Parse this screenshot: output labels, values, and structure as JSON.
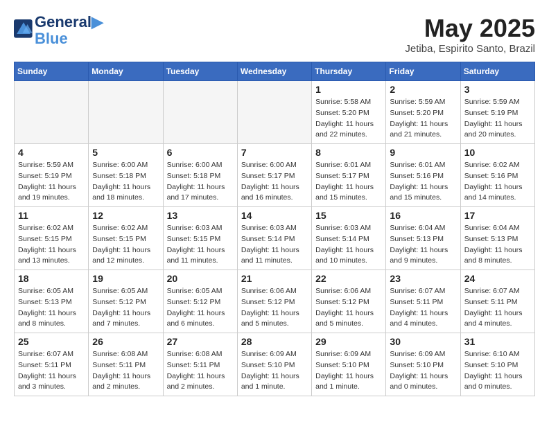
{
  "logo": {
    "line1": "General",
    "line2": "Blue"
  },
  "title": "May 2025",
  "subtitle": "Jetiba, Espirito Santo, Brazil",
  "weekdays": [
    "Sunday",
    "Monday",
    "Tuesday",
    "Wednesday",
    "Thursday",
    "Friday",
    "Saturday"
  ],
  "weeks": [
    [
      {
        "day": "",
        "info": ""
      },
      {
        "day": "",
        "info": ""
      },
      {
        "day": "",
        "info": ""
      },
      {
        "day": "",
        "info": ""
      },
      {
        "day": "1",
        "info": "Sunrise: 5:58 AM\nSunset: 5:20 PM\nDaylight: 11 hours\nand 22 minutes."
      },
      {
        "day": "2",
        "info": "Sunrise: 5:59 AM\nSunset: 5:20 PM\nDaylight: 11 hours\nand 21 minutes."
      },
      {
        "day": "3",
        "info": "Sunrise: 5:59 AM\nSunset: 5:19 PM\nDaylight: 11 hours\nand 20 minutes."
      }
    ],
    [
      {
        "day": "4",
        "info": "Sunrise: 5:59 AM\nSunset: 5:19 PM\nDaylight: 11 hours\nand 19 minutes."
      },
      {
        "day": "5",
        "info": "Sunrise: 6:00 AM\nSunset: 5:18 PM\nDaylight: 11 hours\nand 18 minutes."
      },
      {
        "day": "6",
        "info": "Sunrise: 6:00 AM\nSunset: 5:18 PM\nDaylight: 11 hours\nand 17 minutes."
      },
      {
        "day": "7",
        "info": "Sunrise: 6:00 AM\nSunset: 5:17 PM\nDaylight: 11 hours\nand 16 minutes."
      },
      {
        "day": "8",
        "info": "Sunrise: 6:01 AM\nSunset: 5:17 PM\nDaylight: 11 hours\nand 15 minutes."
      },
      {
        "day": "9",
        "info": "Sunrise: 6:01 AM\nSunset: 5:16 PM\nDaylight: 11 hours\nand 15 minutes."
      },
      {
        "day": "10",
        "info": "Sunrise: 6:02 AM\nSunset: 5:16 PM\nDaylight: 11 hours\nand 14 minutes."
      }
    ],
    [
      {
        "day": "11",
        "info": "Sunrise: 6:02 AM\nSunset: 5:15 PM\nDaylight: 11 hours\nand 13 minutes."
      },
      {
        "day": "12",
        "info": "Sunrise: 6:02 AM\nSunset: 5:15 PM\nDaylight: 11 hours\nand 12 minutes."
      },
      {
        "day": "13",
        "info": "Sunrise: 6:03 AM\nSunset: 5:15 PM\nDaylight: 11 hours\nand 11 minutes."
      },
      {
        "day": "14",
        "info": "Sunrise: 6:03 AM\nSunset: 5:14 PM\nDaylight: 11 hours\nand 11 minutes."
      },
      {
        "day": "15",
        "info": "Sunrise: 6:03 AM\nSunset: 5:14 PM\nDaylight: 11 hours\nand 10 minutes."
      },
      {
        "day": "16",
        "info": "Sunrise: 6:04 AM\nSunset: 5:13 PM\nDaylight: 11 hours\nand 9 minutes."
      },
      {
        "day": "17",
        "info": "Sunrise: 6:04 AM\nSunset: 5:13 PM\nDaylight: 11 hours\nand 8 minutes."
      }
    ],
    [
      {
        "day": "18",
        "info": "Sunrise: 6:05 AM\nSunset: 5:13 PM\nDaylight: 11 hours\nand 8 minutes."
      },
      {
        "day": "19",
        "info": "Sunrise: 6:05 AM\nSunset: 5:12 PM\nDaylight: 11 hours\nand 7 minutes."
      },
      {
        "day": "20",
        "info": "Sunrise: 6:05 AM\nSunset: 5:12 PM\nDaylight: 11 hours\nand 6 minutes."
      },
      {
        "day": "21",
        "info": "Sunrise: 6:06 AM\nSunset: 5:12 PM\nDaylight: 11 hours\nand 5 minutes."
      },
      {
        "day": "22",
        "info": "Sunrise: 6:06 AM\nSunset: 5:12 PM\nDaylight: 11 hours\nand 5 minutes."
      },
      {
        "day": "23",
        "info": "Sunrise: 6:07 AM\nSunset: 5:11 PM\nDaylight: 11 hours\nand 4 minutes."
      },
      {
        "day": "24",
        "info": "Sunrise: 6:07 AM\nSunset: 5:11 PM\nDaylight: 11 hours\nand 4 minutes."
      }
    ],
    [
      {
        "day": "25",
        "info": "Sunrise: 6:07 AM\nSunset: 5:11 PM\nDaylight: 11 hours\nand 3 minutes."
      },
      {
        "day": "26",
        "info": "Sunrise: 6:08 AM\nSunset: 5:11 PM\nDaylight: 11 hours\nand 2 minutes."
      },
      {
        "day": "27",
        "info": "Sunrise: 6:08 AM\nSunset: 5:11 PM\nDaylight: 11 hours\nand 2 minutes."
      },
      {
        "day": "28",
        "info": "Sunrise: 6:09 AM\nSunset: 5:10 PM\nDaylight: 11 hours\nand 1 minute."
      },
      {
        "day": "29",
        "info": "Sunrise: 6:09 AM\nSunset: 5:10 PM\nDaylight: 11 hours\nand 1 minute."
      },
      {
        "day": "30",
        "info": "Sunrise: 6:09 AM\nSunset: 5:10 PM\nDaylight: 11 hours\nand 0 minutes."
      },
      {
        "day": "31",
        "info": "Sunrise: 6:10 AM\nSunset: 5:10 PM\nDaylight: 11 hours\nand 0 minutes."
      }
    ]
  ]
}
